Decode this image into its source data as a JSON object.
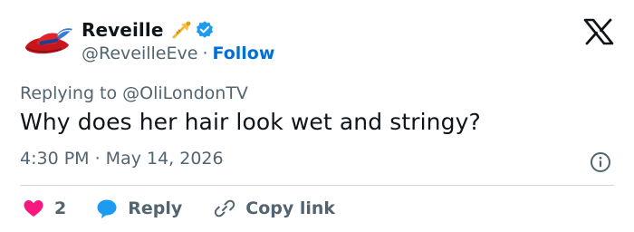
{
  "author": {
    "display_name": "Reveille",
    "handle": "@ReveilleEve",
    "separator": "·",
    "follow_label": "Follow",
    "badge_emoji": "trumpet-icon",
    "verified_badge": "verified-badge-icon",
    "avatar": "red-feathered-hat-avatar"
  },
  "tweet": {
    "replying_prefix": "Replying to",
    "replying_to": "@OliLondonTV",
    "text": "Why does her hair look wet and stringy?",
    "timestamp": "4:30 PM · May 14, 2026"
  },
  "actions": {
    "like_count": "2",
    "reply_label": "Reply",
    "copy_link_label": "Copy link"
  },
  "colors": {
    "text_primary": "#0f1419",
    "text_secondary": "#536471",
    "link": "#006fd6",
    "like": "#f91880",
    "reply": "#1d9bf0",
    "divider": "#cfd9de"
  }
}
